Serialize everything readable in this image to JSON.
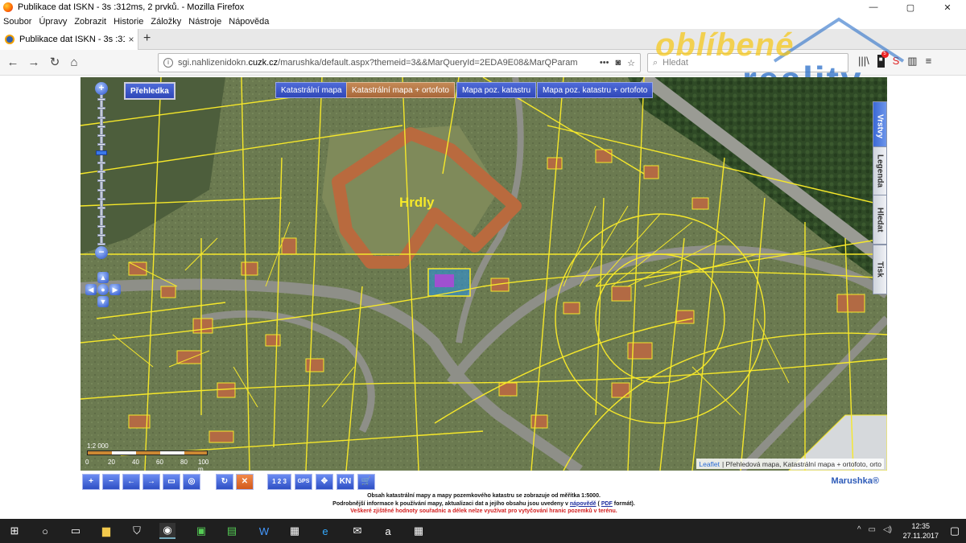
{
  "window": {
    "title": "Publikace dat ISKN - 3s :312ms, 2 prvků. - Mozilla Firefox",
    "controls": [
      "—",
      "▢",
      "✕"
    ]
  },
  "menu": [
    "Soubor",
    "Úpravy",
    "Zobrazit",
    "Historie",
    "Záložky",
    "Nástroje",
    "Nápověda"
  ],
  "tab": {
    "title": "Publikace dat ISKN - 3s :312ms,",
    "close": "×",
    "new_tab": "+"
  },
  "nav": {
    "back": "←",
    "forward": "→",
    "reload": "↻",
    "home": "⌂",
    "url_prefix": "sgi.nahlizenidokn.",
    "url_host": "cuzk.cz",
    "url_path": "/marushka/default.aspx?themeid=3&&MarQueryId=2EDA9E08&MarQParam",
    "url_more": "•••",
    "search_placeholder": "Hledat"
  },
  "watermark": {
    "line1": "oblíbené",
    "line2": "reality"
  },
  "map": {
    "place_label": "Hrdly",
    "overview_button": "Přehledka",
    "layer_buttons": [
      {
        "label": "Katastrální mapa",
        "active": false
      },
      {
        "label": "Katastrální mapa + ortofoto",
        "active": true
      },
      {
        "label": "Mapa poz. katastru",
        "active": false
      },
      {
        "label": "Mapa poz. katastru + ortofoto",
        "active": false
      }
    ],
    "zoom_in": "+",
    "zoom_out": "−",
    "zoom_level": 0.36,
    "side_tabs": [
      "Vrstvy",
      "Legenda",
      "Hledat",
      "Tisk"
    ],
    "scale": {
      "ratio": "1:2 000",
      "ticks": [
        "0",
        "20",
        "40",
        "60",
        "80",
        "100 m"
      ]
    },
    "attribution_link": "Leaflet",
    "attribution_text": "| Přehledová mapa, Katastrální mapa + ortofoto, orto"
  },
  "toolbar": {
    "buttons": [
      "+",
      "−",
      "←",
      "→",
      "▭",
      "◎",
      "↻",
      "✕",
      "1 2 3",
      "GPS",
      "✥",
      "KN",
      "🛒"
    ],
    "brand": "Marushka®"
  },
  "info": {
    "line1": "Obsah katastrální mapy a mapy pozemkového katastru se zobrazuje od měřítka 1:5000.",
    "line2_a": "Podrobnější informace k používání mapy, aktualizaci dat a jejího obsahu jsou uvedeny v",
    "line2_link": "nápovědě",
    "line2_b": "(",
    "line2_pdf": "PDF",
    "line2_c": "formát).",
    "line3": "Veškeré zjištěné hodnoty souřadnic a délek nelze využívat pro vytyčování hranic pozemků v terénu."
  },
  "taskbar": {
    "time": "12:35",
    "date": "27.11.2017",
    "colors": {
      "background": "#1f1f1f"
    }
  },
  "colors": {
    "parcel_line": "#f6e82a",
    "button_blue": "#2f47b8",
    "button_active": "#a8673a",
    "warning_red": "#d21c1c"
  }
}
